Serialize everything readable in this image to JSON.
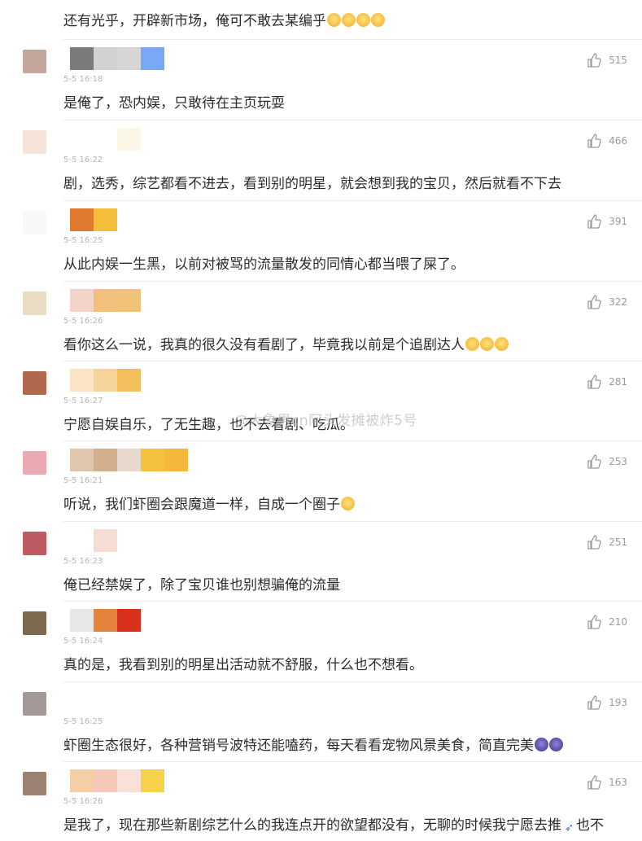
{
  "top_comment_text": "还有光乎，开辟新市场，俺可不敢去某编乎",
  "watermark_text": "@大象男cn阿头发摊被炸5号",
  "comments": [
    {
      "likes": "515",
      "time": "5-5 16:18",
      "text": "是俺了，恐内娱，只敢待在主页玩耍",
      "avatar_color": "#c4a79c",
      "name_colors": [
        "#7b7b7b",
        "#d2d2d2",
        "#d6d6d6",
        "#7aa8f5"
      ]
    },
    {
      "likes": "466",
      "time": "5-5 16:22",
      "text": "剧，选秀，综艺都看不进去，看到别的明星，就会想到我的宝贝，然后就看不下去",
      "avatar_color": "#f6e3da",
      "name_colors": [
        "#ffffff",
        "#ffffff",
        "#fbf6e6"
      ]
    },
    {
      "likes": "391",
      "time": "5-5 16:25",
      "text": "从此内娱一生黑，以前对被骂的流量散发的同情心都当喂了屎了。",
      "avatar_color": "#f8f8f8",
      "name_colors": [
        "#e07a2f",
        "#f4bd3a"
      ]
    },
    {
      "likes": "322",
      "time": "5-5 16:26",
      "text": "看你这么一说，我真的很久没有看剧了，毕竟我以前是个追剧达人",
      "avatar_color": "#e8dcc4",
      "name_colors": [
        "#f4d3c8",
        "#f1c07a",
        "#f0c27a"
      ]
    },
    {
      "likes": "281",
      "time": "5-5 16:27",
      "text": "宁愿自娱自乐，了无生趣，也不去看剧、吃瓜。",
      "avatar_color": "#b0694e",
      "name_colors": [
        "#fbe3c6",
        "#f5d39a",
        "#f3bf5a"
      ]
    },
    {
      "likes": "253",
      "time": "5-5 16:21",
      "text": "听说，我们虾圈会跟魔道一样，自成一个圈子",
      "avatar_color": "#ebaab3",
      "name_colors": [
        "#e0c6ac",
        "#d3ae8a",
        "#e8d8cc",
        "#f5c23e",
        "#f6b83a"
      ]
    },
    {
      "likes": "251",
      "time": "5-5 16:23",
      "text": "俺已经禁娱了，除了宝贝谁也别想骗俺的流量",
      "avatar_color": "#bf5a62",
      "name_colors": [
        "#ffffff",
        "#f6ddd4"
      ]
    },
    {
      "likes": "210",
      "time": "5-5 16:24",
      "text": "真的是，我看到别的明星出活动就不舒服，什么也不想看。",
      "avatar_color": "#7d6a4e",
      "name_colors": [
        "#e7e7e7",
        "#e5823c",
        "#d9301e"
      ]
    },
    {
      "likes": "193",
      "time": "5-5 16:25",
      "text": "虾圈生态很好，各种营销号波特还能嗑药，每天看看宠物风景美食，简直完美",
      "avatar_color": "#a39a98",
      "name_colors": [
        "#ffffff",
        "#ffffff"
      ]
    },
    {
      "likes": "163",
      "time": "5-5 16:26",
      "text": "是我了，现在那些新剧综艺什么的我连点开的欲望都没有，无聊的时候我宁愿去推",
      "text_tail": "也不",
      "avatar_color": "#9c8070",
      "name_colors": [
        "#f4cfa6",
        "#f5c9b8",
        "#f9e1d9",
        "#f5d24a"
      ]
    }
  ]
}
